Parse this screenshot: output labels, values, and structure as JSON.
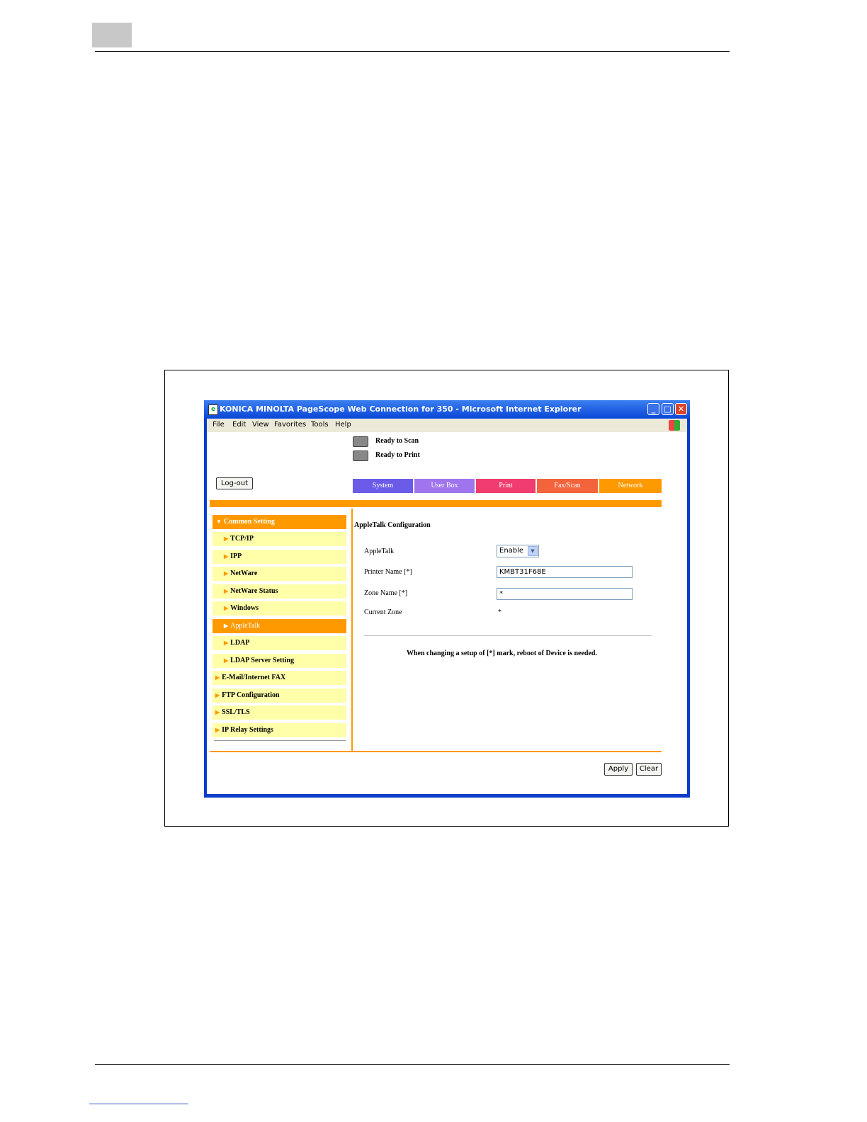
{
  "window": {
    "title": "KONICA MINOLTA PageScope Web Connection for 350 - Microsoft Internet Explorer",
    "minimize_icon": "minimize-icon",
    "maximize_icon": "maximize-icon",
    "close_icon": "close-icon"
  },
  "menubar": {
    "items": [
      "File",
      "Edit",
      "View",
      "Favorites",
      "Tools",
      "Help"
    ]
  },
  "status": {
    "scan": "Ready to Scan",
    "print": "Ready to Print"
  },
  "logout_label": "Log-out",
  "tabs": [
    {
      "label": "System",
      "color": "#6a5ce8"
    },
    {
      "label": "User Box",
      "color": "#9f74ec"
    },
    {
      "label": "Print",
      "color": "#f03c6e"
    },
    {
      "label": "Fax/Scan",
      "color": "#f4643c"
    },
    {
      "label": "Network",
      "color": "#ff9900"
    }
  ],
  "nav": [
    {
      "label": "Common Setting"
    },
    {
      "label": "TCP/IP"
    },
    {
      "label": "IPP"
    },
    {
      "label": "NetWare"
    },
    {
      "label": "NetWare Status"
    },
    {
      "label": "Windows"
    },
    {
      "label": "AppleTalk"
    },
    {
      "label": "LDAP"
    },
    {
      "label": "LDAP Server Setting"
    },
    {
      "label": "E-Mail/Internet FAX"
    },
    {
      "label": "FTP Configuration"
    },
    {
      "label": "SSL/TLS"
    },
    {
      "label": "IP Relay Settings"
    }
  ],
  "config": {
    "title": "AppleTalk Configuration",
    "appletalk_label": "AppleTalk",
    "appletalk_value": "Enable",
    "printer_name_label": "Printer Name [*]",
    "printer_name_value": "KMBT31F68E",
    "zone_name_label": "Zone Name [*]",
    "zone_name_value": "*",
    "current_zone_label": "Current Zone",
    "current_zone_value": "*",
    "note": "When changing a setup of [*] mark, reboot of Device is needed."
  },
  "buttons": {
    "apply": "Apply",
    "clear": "Clear"
  },
  "colors": {
    "accent": "#ff9900",
    "nav_bg": "#ffffaa",
    "window_frame": "#0a3ec8"
  }
}
